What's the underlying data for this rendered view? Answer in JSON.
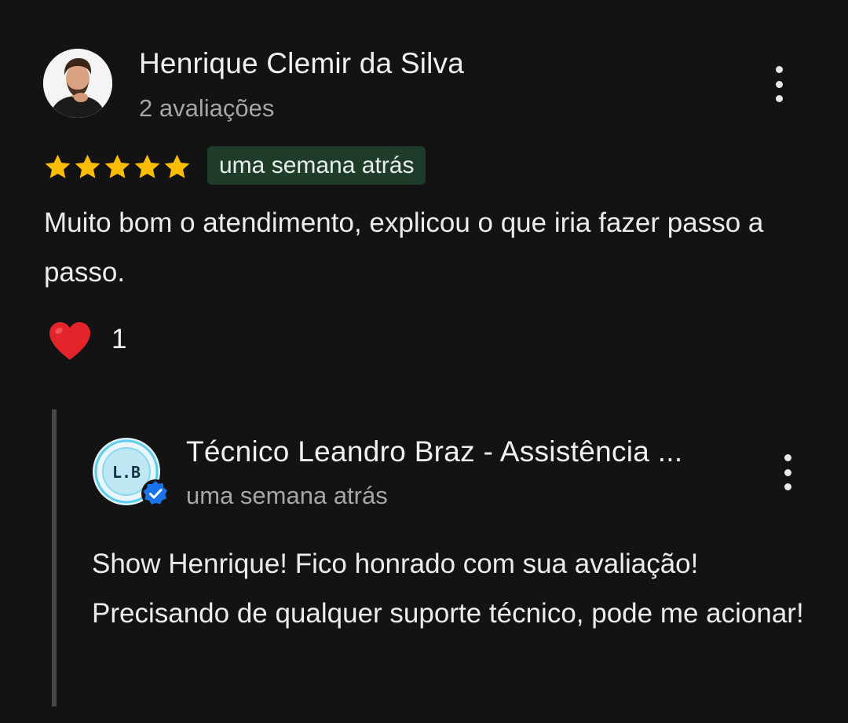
{
  "review": {
    "author_name": "Henrique Clemir da Silva",
    "author_review_count": "2 avaliações",
    "rating_stars": 5,
    "time_ago": "uma semana atrás",
    "text": "Muito bom o atendimento, explicou o que iria fazer passo a passo.",
    "reactions": {
      "icon": "heart-icon",
      "count": "1"
    }
  },
  "owner_reply": {
    "author_name": "Técnico Leandro Braz - Assistência ...",
    "avatar_text": "L.B",
    "time_ago": "uma semana atrás",
    "text": "Show Henrique! Fico honrado com sua avaliação! Precisando de qualquer suporte técnico, pode me acionar!"
  },
  "colors": {
    "background": "#131313",
    "star": "#fbbc04",
    "badge_bg": "#1f3b2a",
    "heart": "#e3242b",
    "verified": "#1a73e8"
  }
}
